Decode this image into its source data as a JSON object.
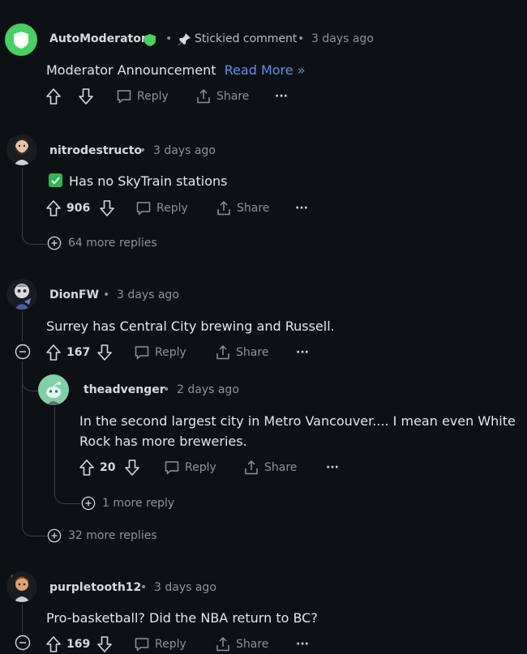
{
  "comments": [
    {
      "author": "AutoModerator",
      "pinned_label": "Stickied comment",
      "time": "3 days ago",
      "body_text": "Moderator Announcement",
      "body_link": "Read More »",
      "reply_label": "Reply",
      "share_label": "Share",
      "more_label": "···"
    },
    {
      "author": "nitrodestructo",
      "time": "3 days ago",
      "body_text": "Has no SkyTrain stations",
      "votes": "906",
      "reply_label": "Reply",
      "share_label": "Share",
      "more_label": "···",
      "more_replies": "64 more replies"
    },
    {
      "author": "DionFW",
      "time": "3 days ago",
      "body_text": "Surrey has Central City brewing and Russell.",
      "votes": "167",
      "reply_label": "Reply",
      "share_label": "Share",
      "more_label": "···",
      "more_replies": "32 more replies"
    },
    {
      "author": "theadvenger",
      "time": "2 days ago",
      "body_line1": "In the second largest city in Metro Vancouver.... I mean even White",
      "body_line2": "Rock has more breweries.",
      "votes": "20",
      "reply_label": "Reply",
      "share_label": "Share",
      "more_label": "···",
      "more_replies": "1 more reply"
    },
    {
      "author": "purpletooth12",
      "time": "3 days ago",
      "body_text": "Pro-basketball? Did the NBA return to BC?",
      "votes": "169",
      "reply_label": "Reply",
      "share_label": "Share",
      "more_label": "···"
    }
  ],
  "colors": {
    "background": "#0e1113",
    "link": "#5c8ff2",
    "mod_green": "#46d160",
    "check_green": "#2db84d"
  },
  "icons": [
    "shield-icon",
    "pin-icon",
    "upvote-icon",
    "downvote-icon",
    "reply-icon",
    "share-icon",
    "plus-circle-icon",
    "collapse-icon",
    "checkbox-icon"
  ]
}
